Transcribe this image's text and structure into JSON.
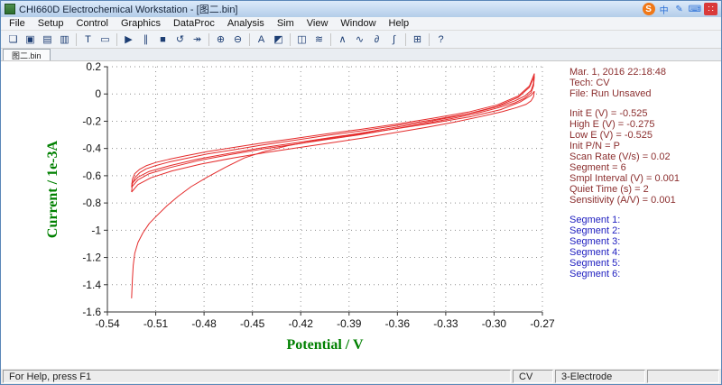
{
  "window": {
    "title": "CHI660D Electrochemical Workstation - [图二.bin]",
    "tray_icons": [
      {
        "name": "sogou",
        "glyph": "S",
        "style": "badge-orange"
      },
      {
        "name": "lang-cn",
        "glyph": "中",
        "style": "blue"
      },
      {
        "name": "pen",
        "glyph": "✎",
        "style": "blue"
      },
      {
        "name": "keyboard",
        "glyph": "⌨",
        "style": "blue"
      },
      {
        "name": "toolbox",
        "glyph": "∷",
        "style": "badge-red"
      }
    ]
  },
  "menu": {
    "items": [
      "File",
      "Setup",
      "Control",
      "Graphics",
      "DataProc",
      "Analysis",
      "Sim",
      "View",
      "Window",
      "Help"
    ]
  },
  "toolbar": {
    "icons": [
      {
        "name": "open-folder",
        "glyph": "❏"
      },
      {
        "name": "save",
        "glyph": "▣"
      },
      {
        "name": "print",
        "glyph": "▤"
      },
      {
        "name": "copy",
        "glyph": "▥"
      },
      {
        "sep": true
      },
      {
        "name": "text-tool",
        "glyph": "T"
      },
      {
        "name": "zoom-box",
        "glyph": "▭"
      },
      {
        "sep": true
      },
      {
        "name": "run",
        "glyph": "▶"
      },
      {
        "name": "pause",
        "glyph": "∥"
      },
      {
        "name": "stop",
        "glyph": "■"
      },
      {
        "name": "reverse-scan",
        "glyph": "↺"
      },
      {
        "name": "continue",
        "glyph": "↠"
      },
      {
        "sep": true
      },
      {
        "name": "zoom-in",
        "glyph": "⊕"
      },
      {
        "name": "zoom-out",
        "glyph": "⊖"
      },
      {
        "sep": true
      },
      {
        "name": "font",
        "glyph": "A"
      },
      {
        "name": "colors",
        "glyph": "◩"
      },
      {
        "sep": true
      },
      {
        "name": "overlay-plot",
        "glyph": "◫"
      },
      {
        "name": "parallel-plot",
        "glyph": "≋"
      },
      {
        "sep": true
      },
      {
        "name": "peak-mark",
        "glyph": "∧"
      },
      {
        "name": "baseline",
        "glyph": "∿"
      },
      {
        "name": "derivative",
        "glyph": "∂"
      },
      {
        "name": "integrate",
        "glyph": "∫"
      },
      {
        "sep": true
      },
      {
        "name": "data-table",
        "glyph": "⊞"
      },
      {
        "sep": true
      },
      {
        "name": "context-help",
        "glyph": "?"
      }
    ]
  },
  "tab": {
    "label": "图二.bin"
  },
  "chart_data": {
    "type": "line",
    "title": "",
    "xlabel": "Potential / V",
    "ylabel": "Current / 1e-3A",
    "xlim": [
      -0.54,
      -0.27
    ],
    "ylim": [
      -1.6,
      0.2
    ],
    "x_ticks": [
      -0.54,
      -0.51,
      -0.48,
      -0.45,
      -0.42,
      -0.39,
      -0.36,
      -0.33,
      -0.3,
      -0.27
    ],
    "x_tick_labels": [
      "-0.54",
      "-0.51",
      "-0.48",
      "-0.45",
      "-0.42",
      "-0.39",
      "-0.36",
      "-0.33",
      "-0.30",
      "-0.27"
    ],
    "y_ticks": [
      0.2,
      0,
      -0.2,
      -0.4,
      -0.6,
      -0.8,
      -1.0,
      -1.2,
      -1.4,
      -1.6
    ],
    "y_tick_labels": [
      "0.2",
      "0",
      "-0.2",
      "-0.4",
      "-0.6",
      "-0.8",
      "-1",
      "-1.2",
      "-1.4",
      "-1.6"
    ],
    "grid": "dotted",
    "line_color": "#e42b2b",
    "series": [
      {
        "name": "Segment 1",
        "points": [
          [
            -0.525,
            -1.5
          ],
          [
            -0.5245,
            -1.36
          ],
          [
            -0.524,
            -1.26
          ],
          [
            -0.523,
            -1.17
          ],
          [
            -0.521,
            -1.09
          ],
          [
            -0.518,
            -1.02
          ],
          [
            -0.514,
            -0.95
          ],
          [
            -0.509,
            -0.89
          ],
          [
            -0.503,
            -0.82
          ],
          [
            -0.496,
            -0.75
          ],
          [
            -0.488,
            -0.68
          ],
          [
            -0.478,
            -0.61
          ],
          [
            -0.467,
            -0.54
          ],
          [
            -0.455,
            -0.47
          ],
          [
            -0.442,
            -0.42
          ],
          [
            -0.428,
            -0.38
          ],
          [
            -0.412,
            -0.345
          ],
          [
            -0.396,
            -0.315
          ],
          [
            -0.378,
            -0.285
          ],
          [
            -0.358,
            -0.25
          ],
          [
            -0.336,
            -0.21
          ],
          [
            -0.314,
            -0.165
          ],
          [
            -0.296,
            -0.115
          ],
          [
            -0.284,
            -0.06
          ],
          [
            -0.277,
            -0.01
          ],
          [
            -0.275,
            0.02
          ]
        ]
      },
      {
        "name": "Segment 2",
        "points": [
          [
            -0.275,
            0.02
          ],
          [
            -0.2755,
            -0.02
          ],
          [
            -0.277,
            -0.05
          ],
          [
            -0.28,
            -0.075
          ],
          [
            -0.286,
            -0.1
          ],
          [
            -0.295,
            -0.13
          ],
          [
            -0.308,
            -0.165
          ],
          [
            -0.324,
            -0.205
          ],
          [
            -0.342,
            -0.245
          ],
          [
            -0.362,
            -0.285
          ],
          [
            -0.382,
            -0.325
          ],
          [
            -0.402,
            -0.36
          ],
          [
            -0.422,
            -0.395
          ],
          [
            -0.442,
            -0.43
          ],
          [
            -0.462,
            -0.47
          ],
          [
            -0.482,
            -0.515
          ],
          [
            -0.5,
            -0.565
          ],
          [
            -0.513,
            -0.615
          ],
          [
            -0.521,
            -0.665
          ],
          [
            -0.525,
            -0.72
          ]
        ]
      },
      {
        "name": "Segment 3",
        "points": [
          [
            -0.525,
            -0.72
          ],
          [
            -0.5245,
            -0.66
          ],
          [
            -0.523,
            -0.615
          ],
          [
            -0.52,
            -0.578
          ],
          [
            -0.516,
            -0.55
          ],
          [
            -0.51,
            -0.525
          ],
          [
            -0.502,
            -0.5
          ],
          [
            -0.492,
            -0.475
          ],
          [
            -0.478,
            -0.44
          ],
          [
            -0.462,
            -0.41
          ],
          [
            -0.444,
            -0.375
          ],
          [
            -0.424,
            -0.34
          ],
          [
            -0.404,
            -0.305
          ],
          [
            -0.382,
            -0.27
          ],
          [
            -0.36,
            -0.23
          ],
          [
            -0.338,
            -0.19
          ],
          [
            -0.316,
            -0.145
          ],
          [
            -0.298,
            -0.09
          ],
          [
            -0.285,
            -0.025
          ],
          [
            -0.278,
            0.05
          ],
          [
            -0.275,
            0.13
          ]
        ]
      },
      {
        "name": "Segment 4",
        "points": [
          [
            -0.275,
            0.13
          ],
          [
            -0.2755,
            0.06
          ],
          [
            -0.277,
            0.01
          ],
          [
            -0.281,
            -0.03
          ],
          [
            -0.287,
            -0.065
          ],
          [
            -0.297,
            -0.1
          ],
          [
            -0.31,
            -0.14
          ],
          [
            -0.326,
            -0.18
          ],
          [
            -0.344,
            -0.22
          ],
          [
            -0.364,
            -0.26
          ],
          [
            -0.384,
            -0.3
          ],
          [
            -0.404,
            -0.335
          ],
          [
            -0.424,
            -0.37
          ],
          [
            -0.444,
            -0.405
          ],
          [
            -0.464,
            -0.445
          ],
          [
            -0.484,
            -0.49
          ],
          [
            -0.501,
            -0.54
          ],
          [
            -0.514,
            -0.585
          ],
          [
            -0.521,
            -0.63
          ],
          [
            -0.525,
            -0.685
          ]
        ]
      },
      {
        "name": "Segment 5",
        "points": [
          [
            -0.525,
            -0.685
          ],
          [
            -0.5245,
            -0.625
          ],
          [
            -0.523,
            -0.585
          ],
          [
            -0.52,
            -0.553
          ],
          [
            -0.516,
            -0.527
          ],
          [
            -0.51,
            -0.503
          ],
          [
            -0.502,
            -0.48
          ],
          [
            -0.492,
            -0.455
          ],
          [
            -0.478,
            -0.423
          ],
          [
            -0.462,
            -0.393
          ],
          [
            -0.444,
            -0.36
          ],
          [
            -0.424,
            -0.327
          ],
          [
            -0.404,
            -0.293
          ],
          [
            -0.382,
            -0.258
          ],
          [
            -0.36,
            -0.22
          ],
          [
            -0.338,
            -0.178
          ],
          [
            -0.316,
            -0.133
          ],
          [
            -0.298,
            -0.08
          ],
          [
            -0.285,
            -0.015
          ],
          [
            -0.278,
            0.06
          ],
          [
            -0.275,
            0.15
          ]
        ]
      },
      {
        "name": "Segment 6",
        "points": [
          [
            -0.275,
            0.15
          ],
          [
            -0.2755,
            0.08
          ],
          [
            -0.277,
            0.025
          ],
          [
            -0.281,
            -0.015
          ],
          [
            -0.287,
            -0.05
          ],
          [
            -0.297,
            -0.09
          ],
          [
            -0.31,
            -0.13
          ],
          [
            -0.326,
            -0.17
          ],
          [
            -0.344,
            -0.21
          ],
          [
            -0.364,
            -0.25
          ],
          [
            -0.384,
            -0.29
          ],
          [
            -0.404,
            -0.325
          ],
          [
            -0.424,
            -0.36
          ],
          [
            -0.444,
            -0.395
          ],
          [
            -0.464,
            -0.435
          ],
          [
            -0.484,
            -0.478
          ],
          [
            -0.501,
            -0.525
          ],
          [
            -0.514,
            -0.568
          ],
          [
            -0.521,
            -0.61
          ],
          [
            -0.525,
            -0.66
          ]
        ]
      }
    ]
  },
  "info_panel": {
    "timestamp": "Mar. 1, 2016  22:18:48",
    "tech": "Tech: CV",
    "file": "File: Run Unsaved",
    "params": [
      "Init E (V) = -0.525",
      "High E (V) = -0.275",
      "Low E (V) = -0.525",
      "Init P/N = P",
      "Scan Rate (V/s) = 0.02",
      "Segment = 6",
      "Smpl Interval (V) = 0.001",
      "Quiet Time (s) = 2",
      "Sensitivity (A/V) = 0.001"
    ],
    "segments": [
      "Segment 1:",
      "Segment 2:",
      "Segment 3:",
      "Segment 4:",
      "Segment 5:",
      "Segment 6:"
    ]
  },
  "status_bar": {
    "help": "For Help, press F1",
    "tech": "CV",
    "electrode": "3-Electrode"
  }
}
